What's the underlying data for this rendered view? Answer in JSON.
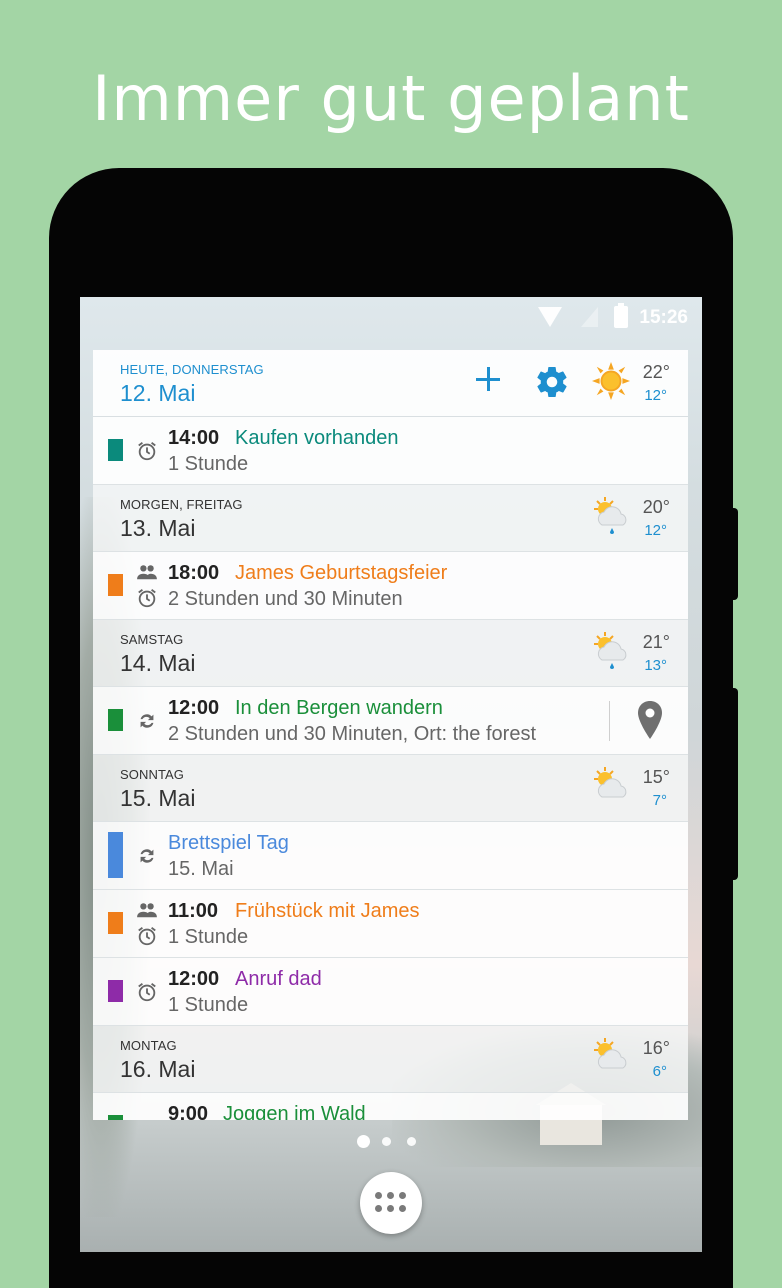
{
  "headline": "Immer gut geplant",
  "status": {
    "time": "15:26"
  },
  "colors": {
    "teal": "#0b8a7c",
    "green": "#1a8f3a",
    "orange": "#ef7d1a",
    "blue": "#4a89dc",
    "purple": "#8e2ba8",
    "accent": "#1e8fcf"
  },
  "header": {
    "day_label": "HEUTE, DONNERSTAG",
    "date": "12. Mai",
    "temp_high": "22°",
    "temp_low": "12°",
    "weather_icon": "sun-icon"
  },
  "days": [
    {
      "label": "MORGEN, FREITAG",
      "date": "13. Mai",
      "temp_high": "20°",
      "temp_low": "12°",
      "weather_icon": "sun-cloud-rain-icon"
    },
    {
      "label": "SAMSTAG",
      "date": "14. Mai",
      "temp_high": "21°",
      "temp_low": "13°",
      "weather_icon": "sun-cloud-rain-icon"
    },
    {
      "label": "SONNTAG",
      "date": "15. Mai",
      "temp_high": "15°",
      "temp_low": "7°",
      "weather_icon": "sun-cloud-icon"
    },
    {
      "label": "MONTAG",
      "date": "16. Mai",
      "temp_high": "16°",
      "temp_low": "6°",
      "weather_icon": "sun-cloud-icon"
    }
  ],
  "events": [
    {
      "time": "14:00",
      "title": "Kaufen vorhanden",
      "sub": "1 Stunde",
      "color": "teal"
    },
    {
      "time": "18:00",
      "title": "James Geburtstagsfeier",
      "sub": "2 Stunden und 30 Minuten",
      "color": "orange"
    },
    {
      "time": "12:00",
      "title": "In den Bergen wandern",
      "sub": "2 Stunden und 30 Minuten, Ort: the forest",
      "color": "green"
    },
    {
      "time": "",
      "title": "Brettspiel Tag",
      "sub": "15. Mai",
      "color": "blue"
    },
    {
      "time": "11:00",
      "title": "Frühstück mit James",
      "sub": "1 Stunde",
      "color": "orange"
    },
    {
      "time": "12:00",
      "title": "Anruf dad",
      "sub": "1 Stunde",
      "color": "purple"
    },
    {
      "time": "9:00",
      "title": "Joggen im Wald",
      "sub": "",
      "color": "green"
    }
  ]
}
